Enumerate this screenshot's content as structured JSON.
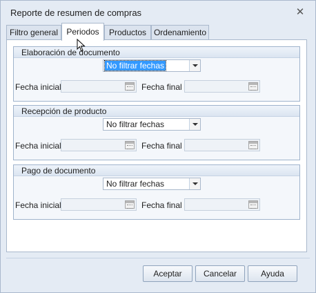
{
  "window": {
    "title": "Reporte de resumen de compras",
    "close_glyph": "✕"
  },
  "tabs": [
    {
      "label": "Filtro general"
    },
    {
      "label": "Periodos"
    },
    {
      "label": "Productos"
    },
    {
      "label": "Ordenamiento"
    }
  ],
  "active_tab": "Periodos",
  "groups": [
    {
      "title": "Elaboración de documento",
      "combo_value": "No filtrar fechas",
      "start_label": "Fecha inicial",
      "end_label": "Fecha final",
      "start_value": "",
      "end_value": ""
    },
    {
      "title": "Recepción de producto",
      "combo_value": "No filtrar fechas",
      "start_label": "Fecha inicial",
      "end_label": "Fecha final",
      "start_value": "",
      "end_value": ""
    },
    {
      "title": "Pago de documento",
      "combo_value": "No filtrar fechas",
      "start_label": "Fecha inicial",
      "end_label": "Fecha final",
      "start_value": "",
      "end_value": ""
    }
  ],
  "buttons": {
    "accept": "Aceptar",
    "cancel": "Cancelar",
    "help": "Ayuda"
  },
  "icons": {
    "close": "close-icon",
    "calendar": "calendar-icon",
    "dropdown": "chevron-down-icon",
    "cursor": "mouse-pointer-icon"
  },
  "colors": {
    "window_bg": "#e4ebf4",
    "panel_bg": "#ffffff",
    "selection": "#3399ff",
    "border": "#a9b8cc"
  }
}
